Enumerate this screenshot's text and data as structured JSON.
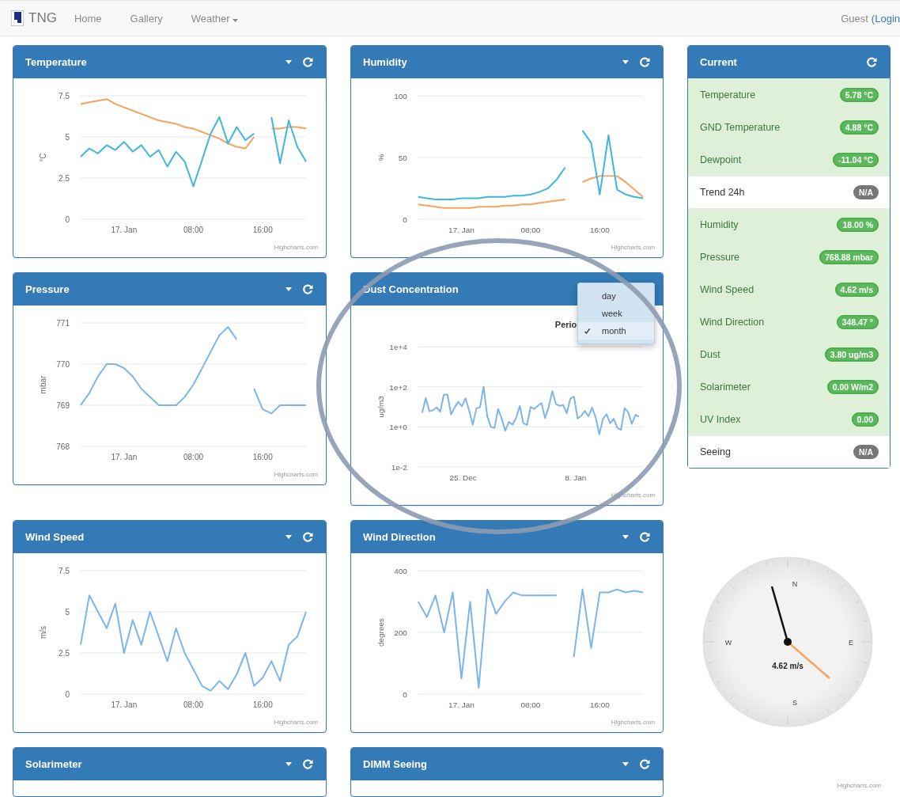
{
  "nav": {
    "brand": "TNG",
    "links": [
      {
        "label": "Home",
        "dropdown": false
      },
      {
        "label": "Gallery",
        "dropdown": false
      },
      {
        "label": "Weather",
        "dropdown": true
      }
    ],
    "user": "Guest",
    "login": "(Login"
  },
  "panels": [
    {
      "title": "Temperature",
      "credit": "Highcharts.com",
      "chart_data": {
        "type": "line",
        "ylabel": "°C",
        "categories": [
          null,
          null,
          null,
          null,
          null,
          "17. Jan",
          null,
          null,
          null,
          null,
          null,
          null,
          null,
          "08:00",
          null,
          null,
          null,
          null,
          null,
          null,
          null,
          "16:00",
          null,
          null,
          null,
          null,
          null
        ],
        "ylim": [
          0,
          7.5
        ],
        "yticks": [
          0,
          2.5,
          5,
          7.5
        ],
        "series": [
          {
            "color": "#f7a35c",
            "values": [
              7.0,
              7.1,
              7.2,
              7.3,
              7.0,
              6.8,
              6.6,
              6.4,
              6.2,
              6.0,
              5.9,
              5.8,
              5.6,
              5.5,
              5.3,
              5.1,
              4.9,
              4.6,
              4.4,
              4.3,
              5.0,
              null,
              5.5,
              5.5,
              5.6,
              5.6,
              5.5
            ]
          },
          {
            "color": "#3fb6dc",
            "values": [
              3.8,
              4.3,
              4.0,
              4.5,
              4.2,
              4.7,
              4.1,
              4.5,
              3.8,
              4.2,
              3.2,
              4.1,
              3.5,
              2.0,
              3.6,
              5.2,
              6.2,
              4.6,
              5.6,
              4.8,
              5.2,
              null,
              6.2,
              3.4,
              6.0,
              4.4,
              3.5
            ]
          }
        ]
      }
    },
    {
      "title": "Humidity",
      "credit": "Highcharts.com",
      "chart_data": {
        "type": "line",
        "ylabel": "%",
        "categories": [
          null,
          null,
          null,
          null,
          null,
          "17. Jan",
          null,
          null,
          null,
          null,
          null,
          null,
          null,
          "08:00",
          null,
          null,
          null,
          null,
          null,
          null,
          null,
          "16:00",
          null,
          null,
          null,
          null,
          null
        ],
        "ylim": [
          0,
          100
        ],
        "yticks": [
          0,
          50,
          100
        ],
        "series": [
          {
            "color": "#f7a35c",
            "values": [
              12,
              11,
              10,
              9,
              9,
              9,
              9,
              10,
              10,
              10,
              11,
              11,
              12,
              12,
              13,
              14,
              15,
              16,
              null,
              30,
              33,
              35,
              35,
              35,
              30,
              24,
              18
            ]
          },
          {
            "color": "#3fb6dc",
            "values": [
              18,
              17,
              16,
              16,
              16,
              17,
              17,
              17,
              18,
              18,
              18,
              19,
              19,
              20,
              22,
              25,
              32,
              42,
              null,
              72,
              62,
              20,
              68,
              24,
              20,
              18,
              17
            ]
          }
        ]
      }
    },
    {
      "title": "Pressure",
      "credit": "Highcharts.com",
      "chart_data": {
        "type": "line",
        "ylabel": "mbar",
        "categories": [
          null,
          null,
          null,
          null,
          null,
          "17. Jan",
          null,
          null,
          null,
          null,
          null,
          null,
          null,
          "08:00",
          null,
          null,
          null,
          null,
          null,
          null,
          null,
          "16:00",
          null,
          null,
          null,
          null,
          null
        ],
        "ylim": [
          768,
          771
        ],
        "yticks": [
          768,
          769,
          770,
          771
        ],
        "series": [
          {
            "color": "#7cb5ec",
            "values": [
              769.0,
              769.3,
              769.7,
              770.0,
              770.0,
              769.9,
              769.7,
              769.4,
              769.2,
              769.0,
              769.0,
              769.0,
              769.2,
              769.5,
              769.9,
              770.3,
              770.7,
              770.9,
              770.6,
              null,
              769.4,
              768.9,
              768.8,
              769.0,
              769.0,
              769.0,
              769.0
            ]
          }
        ]
      }
    },
    {
      "title": "Dust Concentration",
      "credit": "Highcharts.com",
      "period": "Perio",
      "menu": {
        "items": [
          {
            "label": "day",
            "selected": false
          },
          {
            "label": "week",
            "selected": false
          },
          {
            "label": "month",
            "selected": true
          }
        ]
      },
      "plot": {
        "ylabel": "ug/m3",
        "y_labels": [
          "1e+4",
          "1e+2",
          "1e+0",
          "1e-2"
        ],
        "x_labels": [
          "25. Dec",
          "8. Jan"
        ]
      }
    },
    {
      "title": "Wind Speed",
      "credit": "Highcharts.com",
      "chart_data": {
        "type": "line",
        "ylabel": "m/s",
        "categories": [
          null,
          null,
          null,
          null,
          null,
          "17. Jan",
          null,
          null,
          null,
          null,
          null,
          null,
          null,
          "08:00",
          null,
          null,
          null,
          null,
          null,
          null,
          null,
          "16:00",
          null,
          null,
          null,
          null,
          null
        ],
        "ylim": [
          0,
          7.5
        ],
        "yticks": [
          0,
          2.5,
          5,
          7.5
        ],
        "series": [
          {
            "color": "#7cb5ec",
            "values": [
              3.0,
              6.0,
              5.0,
              4.0,
              5.5,
              2.5,
              4.5,
              3.0,
              5.0,
              3.5,
              2.0,
              4.0,
              2.5,
              1.5,
              0.5,
              0.2,
              0.8,
              0.3,
              1.2,
              2.5,
              0.5,
              1.0,
              2.0,
              0.8,
              3.0,
              3.5,
              5.0
            ]
          }
        ]
      }
    },
    {
      "title": "Wind Direction",
      "credit": "Highcharts.com",
      "chart_data": {
        "type": "line",
        "ylabel": "degrees",
        "categories": [
          null,
          null,
          null,
          null,
          null,
          "17. Jan",
          null,
          null,
          null,
          null,
          null,
          null,
          null,
          "08:00",
          null,
          null,
          null,
          null,
          null,
          null,
          null,
          "16:00",
          null,
          null,
          null,
          null,
          null
        ],
        "ylim": [
          0,
          400
        ],
        "yticks": [
          0,
          200,
          400
        ],
        "series": [
          {
            "color": "#7cb5ec",
            "values": [
              300,
              250,
              320,
              200,
              330,
              50,
              300,
              20,
              340,
              260,
              300,
              330,
              320,
              320,
              320,
              320,
              320,
              null,
              120,
              340,
              150,
              330,
              330,
              340,
              330,
              335,
              330
            ]
          }
        ]
      }
    },
    {
      "title": "Solarimeter"
    },
    {
      "title": "DIMM Seeing"
    }
  ],
  "current": {
    "title": "Current",
    "rows": [
      {
        "label": "Temperature",
        "value": "5.78 °C",
        "kind": "ok"
      },
      {
        "label": "GND Temperature",
        "value": "4.88 °C",
        "kind": "ok"
      },
      {
        "label": "Dewpoint",
        "value": "-11.04 °C",
        "kind": "ok"
      },
      {
        "label": "Trend 24h",
        "value": "N/A",
        "kind": "na"
      },
      {
        "label": "Humidity",
        "value": "18.00 %",
        "kind": "ok"
      },
      {
        "label": "Pressure",
        "value": "768.88 mbar",
        "kind": "ok"
      },
      {
        "label": "Wind Speed",
        "value": "4.62 m/s",
        "kind": "ok"
      },
      {
        "label": "Wind Direction",
        "value": "348.47 °",
        "kind": "ok"
      },
      {
        "label": "Dust",
        "value": "3.80 ug/m3",
        "kind": "ok"
      },
      {
        "label": "Solarimeter",
        "value": "0.00 W/m2",
        "kind": "ok"
      },
      {
        "label": "UV Index",
        "value": "0.00",
        "kind": "ok"
      },
      {
        "label": "Seeing",
        "value": "N/A",
        "kind": "na"
      }
    ]
  },
  "gauge": {
    "labels": [
      "N",
      "E",
      "S",
      "W"
    ],
    "value": "4.62 m/s",
    "credit": "Highcharts.com"
  }
}
